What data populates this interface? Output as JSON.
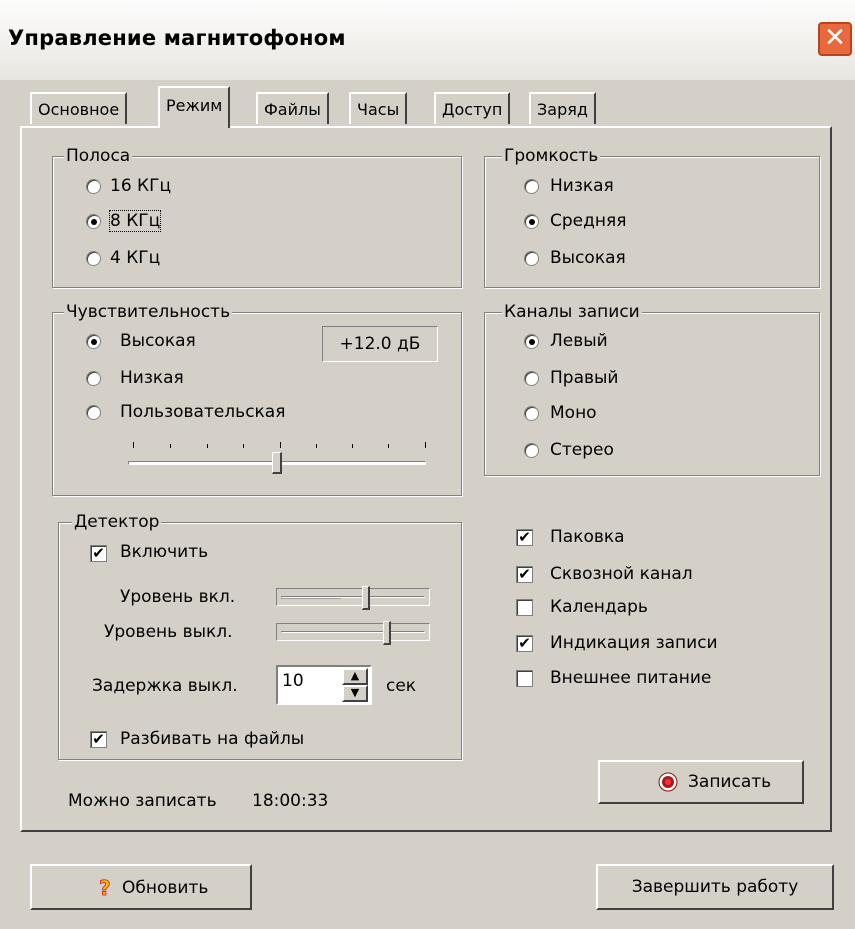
{
  "window": {
    "title": "Управление магнитофоном",
    "close_symbol": "✕"
  },
  "tabs": [
    {
      "label": "Основное",
      "active": false
    },
    {
      "label": "Режим",
      "active": true
    },
    {
      "label": "Файлы",
      "active": false
    },
    {
      "label": "Часы",
      "active": false
    },
    {
      "label": "Доступ",
      "active": false
    },
    {
      "label": "Заряд",
      "active": false
    }
  ],
  "band": {
    "title": "Полоса",
    "options": [
      "16 КГц",
      "8 КГц",
      "4 КГц"
    ],
    "selected": "8 КГц"
  },
  "volume": {
    "title": "Громкость",
    "options": [
      "Низкая",
      "Средняя",
      "Высокая"
    ],
    "selected": "Средняя"
  },
  "sensitivity": {
    "title": "Чувствительность",
    "options": [
      "Высокая",
      "Низкая",
      "Пользовательская"
    ],
    "selected": "Высокая",
    "gain_readout": "+12.0 дБ",
    "slider_position": 0.5
  },
  "channels": {
    "title": "Каналы записи",
    "options": [
      "Левый",
      "Правый",
      "Моно",
      "Стерео"
    ],
    "selected": "Левый"
  },
  "detector": {
    "title": "Детектор",
    "enable_label": "Включить",
    "enable_checked": true,
    "on_level_label": "Уровень вкл.",
    "on_level": 0.6,
    "off_level_label": "Уровень выкл.",
    "off_level": 0.74,
    "delay_label": "Задержка выкл.",
    "delay_value": "10",
    "delay_unit": "сек",
    "split_label": "Разбивать на файлы",
    "split_checked": true
  },
  "options": [
    {
      "label": "Паковка",
      "checked": true
    },
    {
      "label": "Сквозной канал",
      "checked": true
    },
    {
      "label": "Календарь",
      "checked": false
    },
    {
      "label": "Индикация записи",
      "checked": true
    },
    {
      "label": "Внешнее питание",
      "checked": false
    }
  ],
  "record_button": {
    "label": "Записать",
    "icon": "record-icon"
  },
  "remaining": {
    "label": "Можно записать",
    "value": "18:00:33"
  },
  "refresh_button": {
    "label": "Обновить",
    "icon": "help-icon"
  },
  "exit_button": {
    "label": "Завершить работу"
  }
}
